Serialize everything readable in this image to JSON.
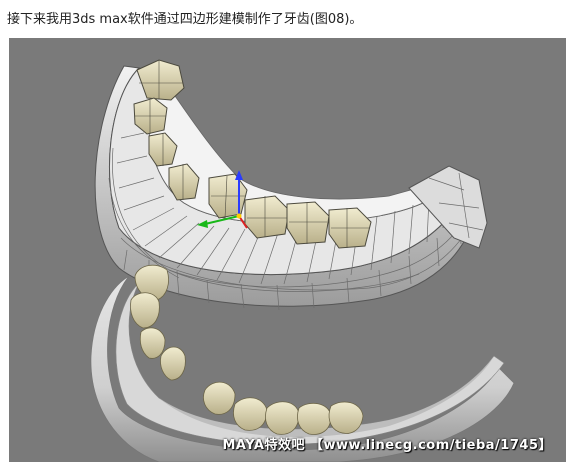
{
  "article": {
    "caption": "接下来我用3ds max软件通过四边形建模制作了牙齿(图08)。"
  },
  "figure": {
    "watermark": "MAYA特效吧 【www.linecg.com/tieba/1745】",
    "background_color": "#7a7a7a",
    "icons": [
      "wireframe-gum-model",
      "rendered-gum-model",
      "transform-gizmo"
    ]
  }
}
